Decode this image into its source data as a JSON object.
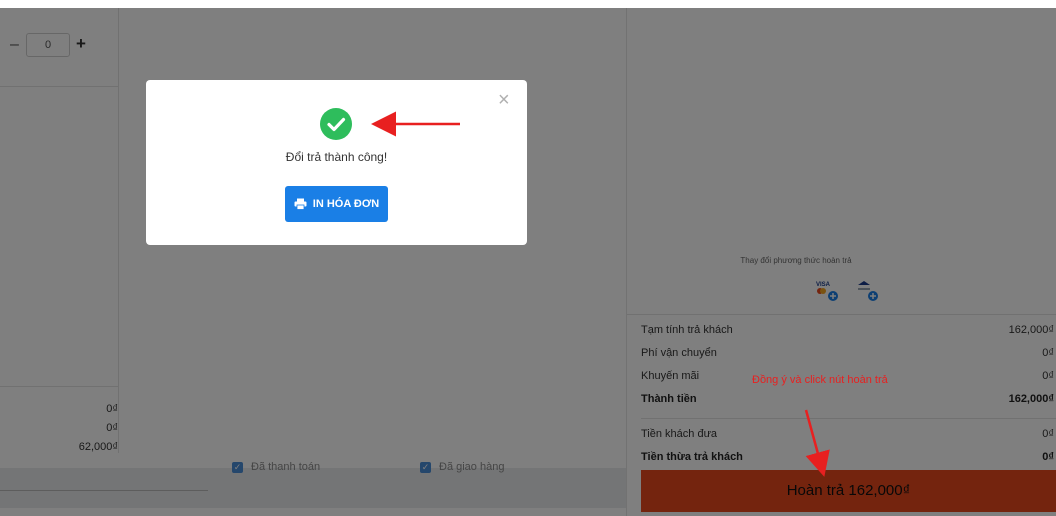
{
  "left": {
    "stepper_value": "0",
    "stepper_minus": "–",
    "stepper_plus": "+",
    "totals": [
      "0₫",
      "0₫",
      "62,000₫"
    ]
  },
  "bottom_bar": {
    "paid_label": "Đã thanh toán",
    "delivered_label": "Đã giao hàng"
  },
  "right": {
    "payment_method_label": "Thay đổi phương thức hoàn trả",
    "summary": {
      "subtotal_label": "Tạm tính trả khách",
      "subtotal_value": "162,000₫",
      "shipping_label": "Phí vận chuyển",
      "shipping_value": "0₫",
      "discount_label": "Khuyến mãi",
      "discount_value": "0₫",
      "total_label": "Thành tiền",
      "total_value": "162,000₫",
      "cash_given_label": "Tiền khách đưa",
      "cash_given_value": "0₫",
      "change_label": "Tiền thừa trả khách",
      "change_value": "0₫"
    },
    "refund_button": "Hoàn trả 162,000₫"
  },
  "modal": {
    "message": "Đổi trả thành công!",
    "print_button": "IN HÓA ĐƠN",
    "close": "×"
  },
  "annotation": {
    "text": "Đồng ý và click nút hoàn trả",
    "color": "#e82020"
  },
  "colors": {
    "accent_blue": "#1a7fe6",
    "success_green": "#2ebd5c",
    "refund_orange": "#e8481c"
  }
}
